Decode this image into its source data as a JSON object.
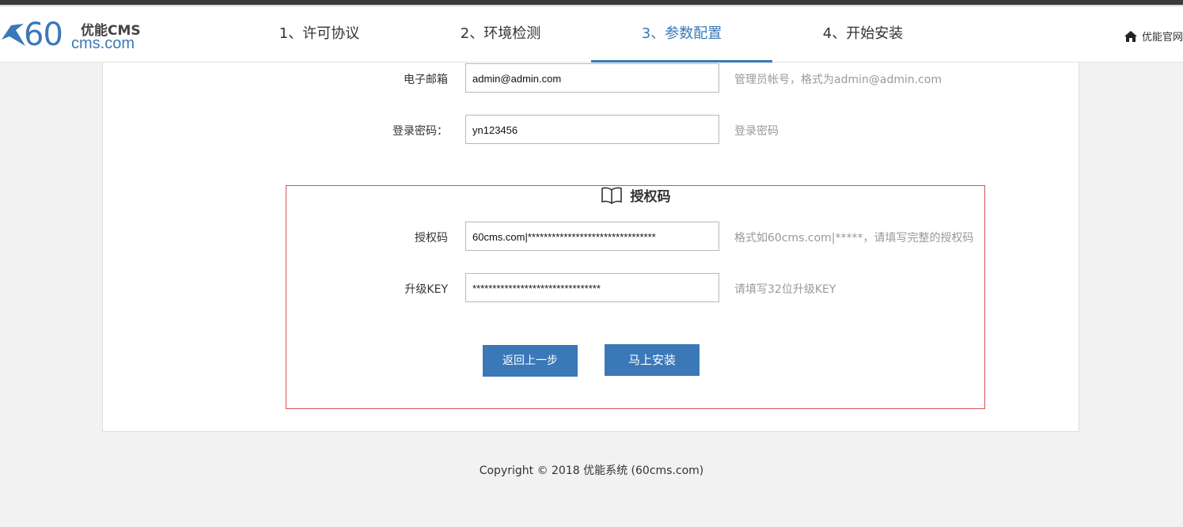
{
  "header": {
    "logo": {
      "big_text": "60",
      "brand": "优能CMS",
      "domain": "cms.com"
    },
    "steps": [
      {
        "label": "1、许可协议"
      },
      {
        "label": "2、环境检测"
      },
      {
        "label": "3、参数配置"
      },
      {
        "label": "4、开始安装"
      }
    ],
    "active_step": 3,
    "home_link": "优能官网"
  },
  "form": {
    "email": {
      "label": "电子邮箱",
      "value": "admin@admin.com",
      "hint": "管理员帐号，格式为admin@admin.com"
    },
    "password": {
      "label": "登录密码：",
      "value": "yn123456",
      "hint": "登录密码"
    }
  },
  "auth": {
    "title": "授权码",
    "code": {
      "label": "授权码",
      "value": "60cms.com|********************************",
      "hint": "格式如60cms.com|*****，请填写完整的授权码"
    },
    "key": {
      "label": "升级KEY",
      "value": "********************************",
      "hint": "请填写32位升级KEY"
    }
  },
  "buttons": {
    "back": "返回上一步",
    "install": "马上安装"
  },
  "footer": {
    "copyright": "Copyright © 2018 优能系统 (60cms.com)"
  },
  "colors": {
    "accent": "#3a78b8",
    "box_border": "#d9534f"
  }
}
